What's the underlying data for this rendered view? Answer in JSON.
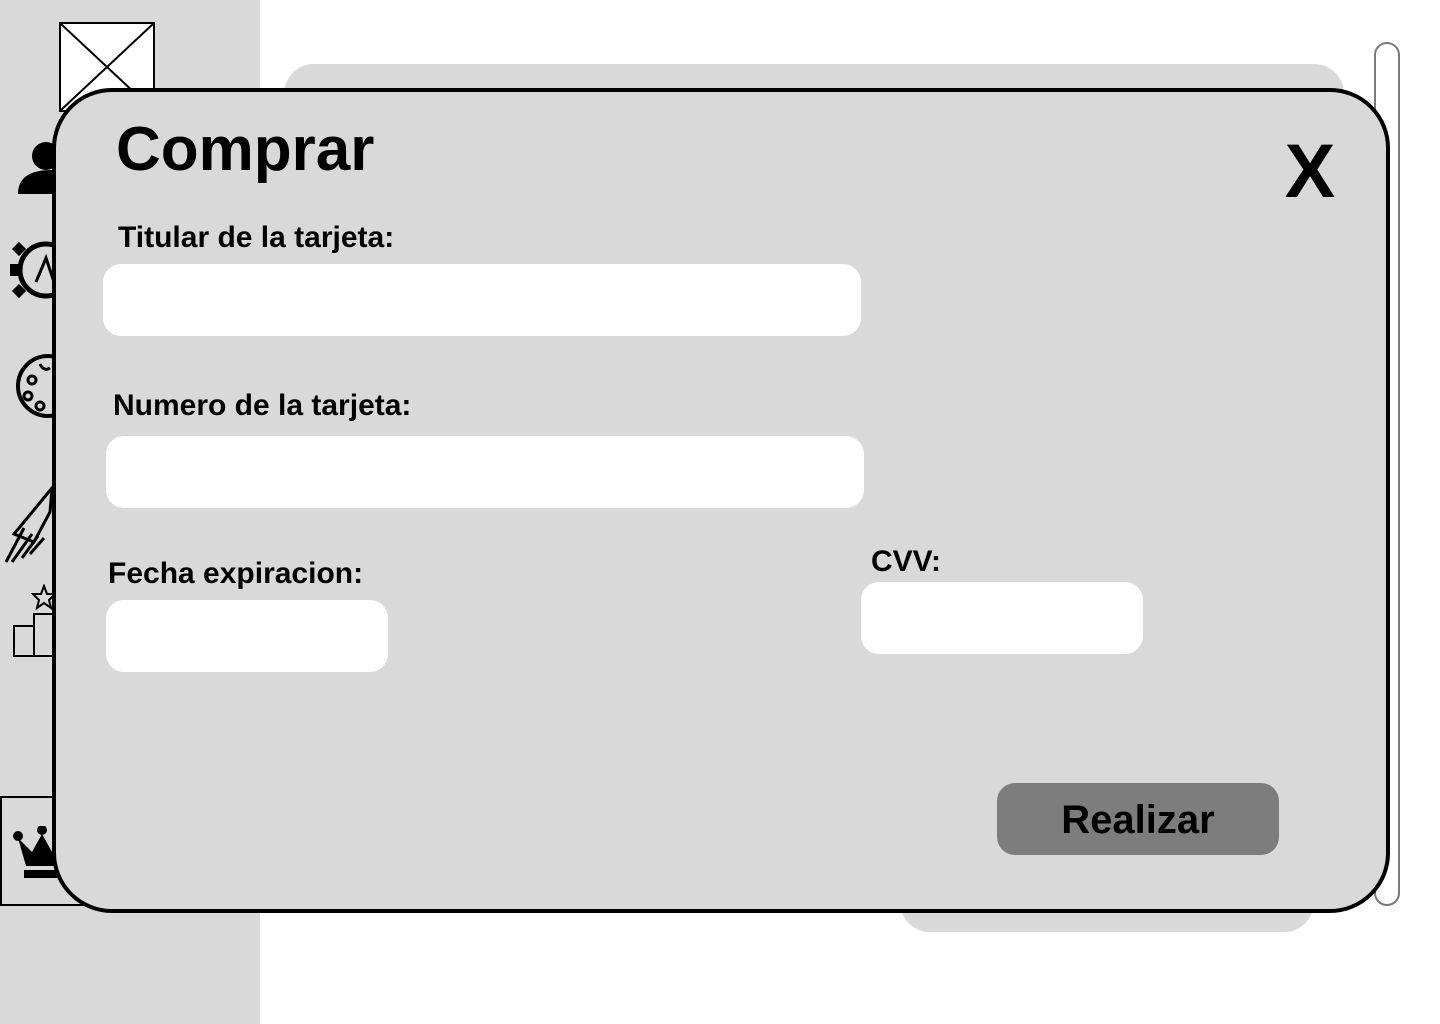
{
  "modal": {
    "title": "Comprar",
    "close_label": "X",
    "fields": {
      "holder": {
        "label": "Titular de la tarjeta:",
        "value": "",
        "placeholder": ""
      },
      "number": {
        "label": "Numero de la tarjeta:",
        "value": "",
        "placeholder": ""
      },
      "expiry": {
        "label": "Fecha expiracion:",
        "value": "",
        "placeholder": ""
      },
      "cvv": {
        "label": "CVV:",
        "value": "",
        "placeholder": ""
      }
    },
    "submit_label": "Realizar"
  },
  "sidebar": {
    "icons": [
      "image-placeholder-icon",
      "user-icon",
      "gear-icon",
      "palette-icon",
      "rocket-icon",
      "podium-star-icon",
      "crown-icon"
    ]
  },
  "colors": {
    "panel_gray": "#d9d9d9",
    "button_gray": "#7d7d7d",
    "input_white": "#ffffff",
    "border_black": "#000000"
  }
}
